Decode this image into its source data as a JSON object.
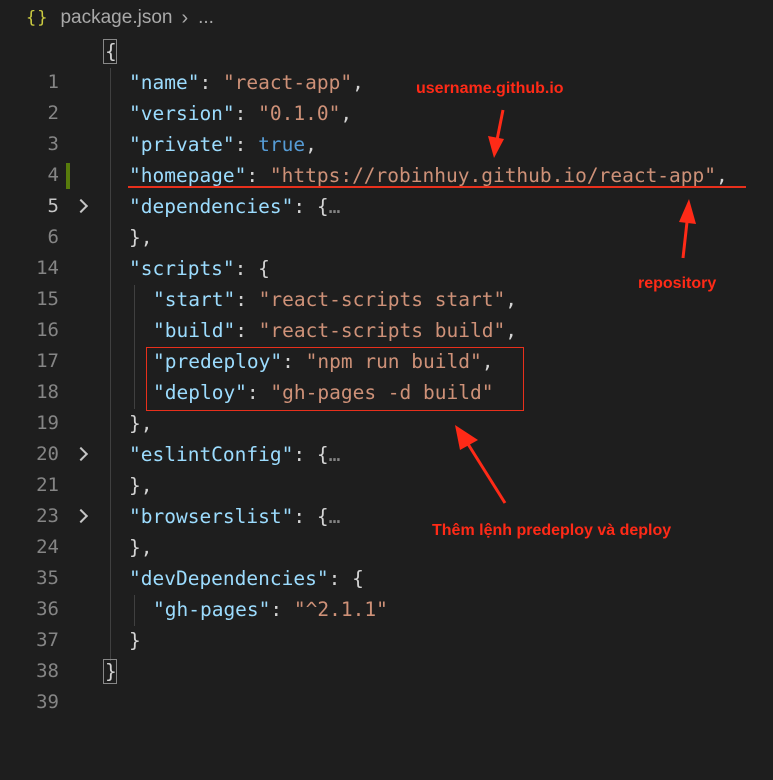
{
  "breadcrumb": {
    "icon": "{}",
    "file": "package.json",
    "separator": "›",
    "more": "..."
  },
  "lines": {
    "l1": {
      "num": "1",
      "open": "{"
    },
    "l2": {
      "num": "2",
      "key": "\"name\"",
      "colon": ": ",
      "val": "\"react-app\"",
      "comma": ","
    },
    "l3": {
      "num": "3",
      "key": "\"version\"",
      "colon": ": ",
      "val": "\"0.1.0\"",
      "comma": ","
    },
    "l4": {
      "num": "4",
      "key": "\"private\"",
      "colon": ": ",
      "val": "true",
      "comma": ","
    },
    "l5": {
      "num": "5",
      "key": "\"homepage\"",
      "colon": ": ",
      "val": "\"https://robinhuy.github.io/react-app\"",
      "comma": ","
    },
    "l6": {
      "num": "6",
      "key": "\"dependencies\"",
      "colon": ": ",
      "open": "{",
      "ellipsis": "…"
    },
    "l14": {
      "num": "14",
      "close": "},"
    },
    "l15": {
      "num": "15",
      "key": "\"scripts\"",
      "colon": ": ",
      "open": "{"
    },
    "l16": {
      "num": "16",
      "key": "\"start\"",
      "colon": ": ",
      "val": "\"react-scripts start\"",
      "comma": ","
    },
    "l17": {
      "num": "17",
      "key": "\"build\"",
      "colon": ": ",
      "val": "\"react-scripts build\"",
      "comma": ","
    },
    "l18": {
      "num": "18",
      "key": "\"predeploy\"",
      "colon": ": ",
      "val": "\"npm run build\"",
      "comma": ","
    },
    "l19": {
      "num": "19",
      "key": "\"deploy\"",
      "colon": ": ",
      "val": "\"gh-pages -d build\""
    },
    "l20": {
      "num": "20",
      "close": "},"
    },
    "l21": {
      "num": "21",
      "key": "\"eslintConfig\"",
      "colon": ": ",
      "open": "{",
      "ellipsis": "…"
    },
    "l23": {
      "num": "23",
      "close": "},"
    },
    "l24": {
      "num": "24",
      "key": "\"browserslist\"",
      "colon": ": ",
      "open": "{",
      "ellipsis": "…"
    },
    "l35": {
      "num": "35",
      "close": "},"
    },
    "l36": {
      "num": "36",
      "key": "\"devDependencies\"",
      "colon": ": ",
      "open": "{"
    },
    "l37": {
      "num": "37",
      "key": "\"gh-pages\"",
      "colon": ": ",
      "val": "\"^2.1.1\""
    },
    "l38": {
      "num": "38",
      "close": "}"
    },
    "l39": {
      "num": "39",
      "close": "}"
    }
  },
  "annotations": {
    "username": "username.github.io",
    "repository": "repository",
    "add_commands": "Thêm lệnh predeploy và deploy"
  },
  "colors": {
    "background": "#1e1e1e",
    "key": "#9cdcfe",
    "string": "#ce9178",
    "boolean": "#569cd6",
    "annotation": "#ff2a17"
  }
}
